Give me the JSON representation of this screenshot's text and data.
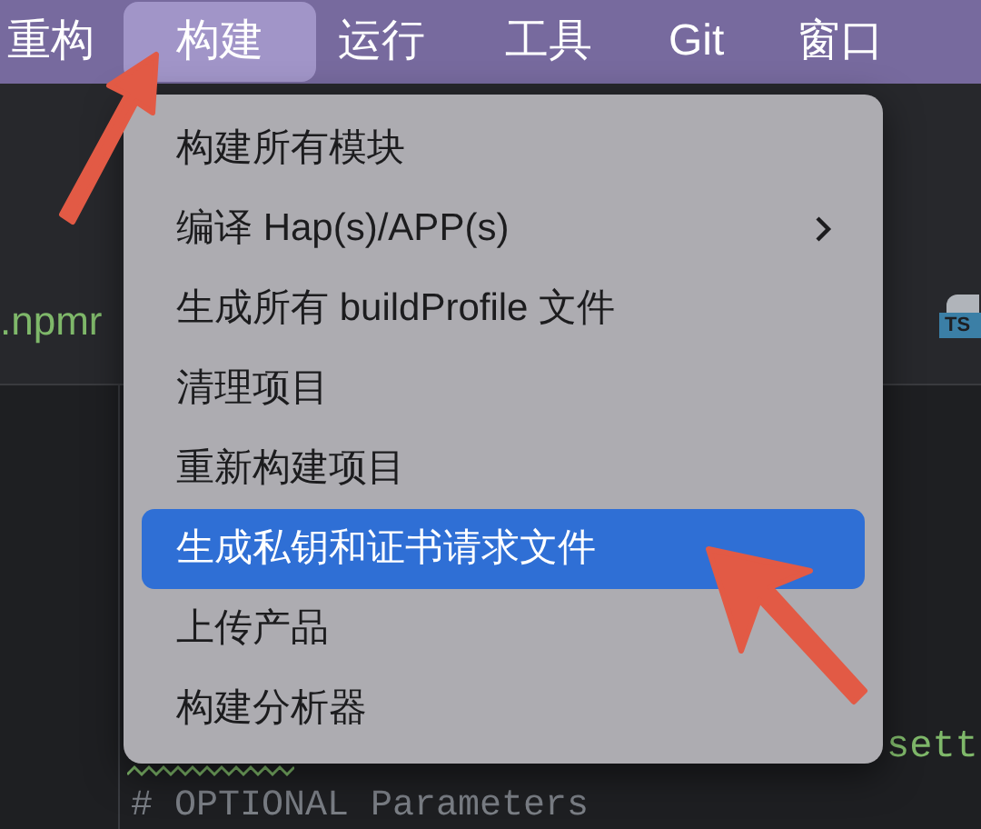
{
  "menu_bar": [
    {
      "label": "重构",
      "selected": false
    },
    {
      "label": "构建",
      "selected": true
    },
    {
      "label": "运行",
      "selected": false
    },
    {
      "label": "工具",
      "selected": false
    },
    {
      "label": "Git",
      "selected": false
    },
    {
      "label": "窗口",
      "selected": false
    }
  ],
  "editor_tab": {
    "label": ".npmr",
    "file_badge": "TS"
  },
  "build_menu": {
    "items": [
      {
        "label": "构建所有模块",
        "selected": false,
        "submenu": false
      },
      {
        "label": "编译 Hap(s)/APP(s)",
        "selected": false,
        "submenu": true
      },
      {
        "label": "生成所有 buildProfile 文件",
        "selected": false,
        "submenu": false
      },
      {
        "label": "清理项目",
        "selected": false,
        "submenu": false
      },
      {
        "label": "重新构建项目",
        "selected": false,
        "submenu": false
      },
      {
        "label": "生成私钥和证书请求文件",
        "selected": true,
        "submenu": false
      },
      {
        "label": "上传产品",
        "selected": false,
        "submenu": false
      },
      {
        "label": "构建分析器",
        "selected": false,
        "submenu": false
      }
    ]
  },
  "code": {
    "right_fragment": "sett",
    "comment_line": "# OPTIONAL Parameters"
  }
}
